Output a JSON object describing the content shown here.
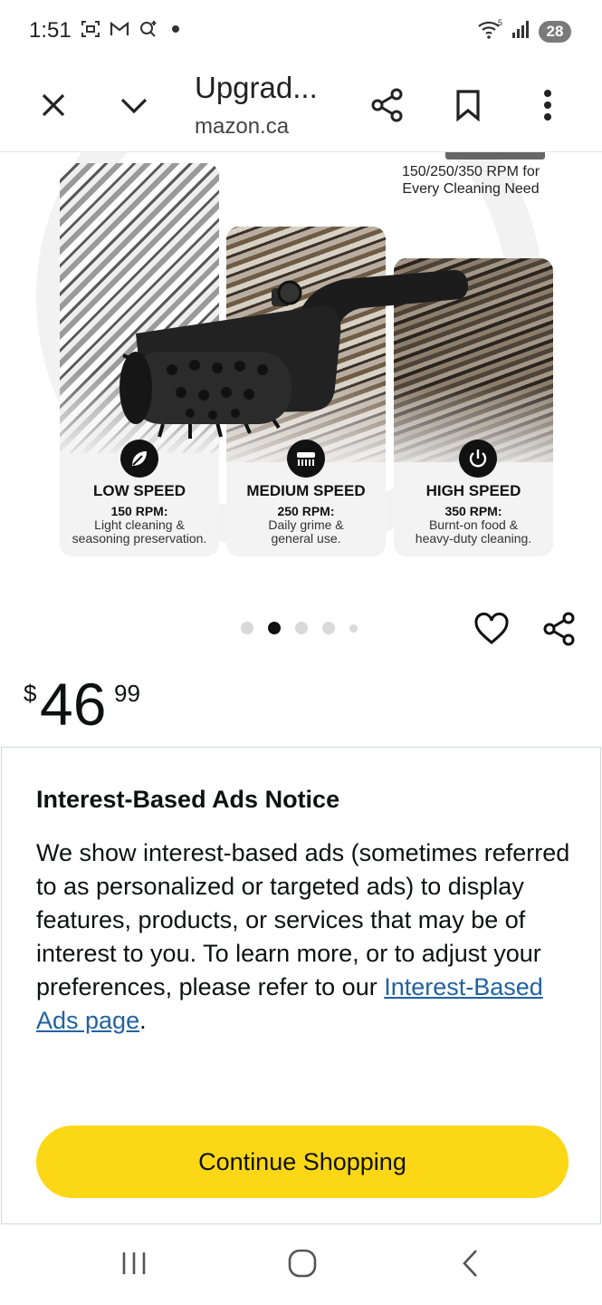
{
  "status_bar": {
    "time": "1:51",
    "battery": "28",
    "signal_superscript": "5",
    "icons": [
      "screenshot-icon",
      "gmail-icon",
      "assistant-icon",
      "notification-dot",
      "wifi-icon",
      "signal-icon",
      "battery-icon"
    ]
  },
  "browser": {
    "title": "Upgrad...",
    "url": "mazon.ca",
    "icons": [
      "close-icon",
      "chevron-down-icon",
      "share-icon",
      "bookmark-icon",
      "more-vert-icon"
    ]
  },
  "product_image": {
    "motor_subtitle_line1": "150/250/350 RPM for",
    "motor_subtitle_line2": "Every Cleaning Need",
    "speeds": [
      {
        "title": "LOW SPEED",
        "rpm": "150 RPM:",
        "desc_line1": "Light cleaning &",
        "desc_line2": "seasoning preservation.",
        "icon": "leaf-icon"
      },
      {
        "title": "MEDIUM SPEED",
        "rpm": "250 RPM:",
        "desc_line1": "Daily grime &",
        "desc_line2": "general use.",
        "icon": "brush-icon"
      },
      {
        "title": "HIGH SPEED",
        "rpm": "350 RPM:",
        "desc_line1": "Burnt-on food &",
        "desc_line2": "heavy-duty cleaning.",
        "icon": "power-icon"
      }
    ]
  },
  "carousel": {
    "dot_count": 5,
    "active_index": 1,
    "icons": [
      "heart-icon",
      "share-icon"
    ]
  },
  "price": {
    "symbol": "$",
    "whole": "46",
    "fraction": "99"
  },
  "notice": {
    "title": "Interest-Based Ads Notice",
    "body_text": "We show interest-based ads (sometimes referred to as personalized or targeted ads) to display features, products, or services that may be of interest to you. To learn more, or to adjust your preferences, please refer to our ",
    "link_text": "Interest-Based Ads page",
    "body_end": ".",
    "button_label": "Continue Shopping"
  },
  "navbar": {
    "icons": [
      "recent-apps-icon",
      "home-icon",
      "back-icon"
    ]
  },
  "colors": {
    "button_yellow": "#fcd716",
    "link_blue": "#2162a1",
    "text": "#0f1111"
  }
}
